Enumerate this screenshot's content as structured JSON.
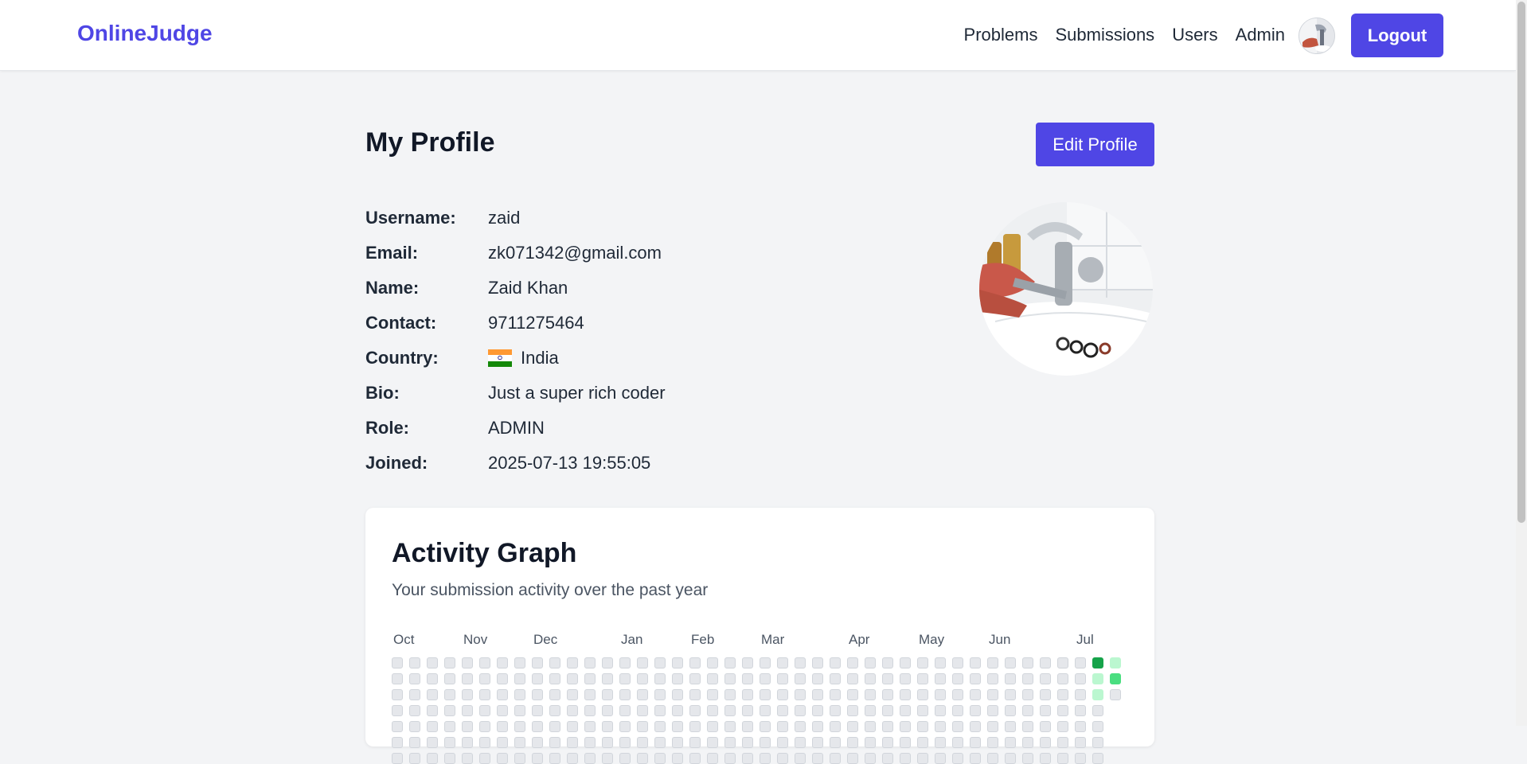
{
  "nav": {
    "brand": "OnlineJudge",
    "links": [
      "Problems",
      "Submissions",
      "Users",
      "Admin"
    ],
    "logout_label": "Logout"
  },
  "profile": {
    "title": "My Profile",
    "edit_label": "Edit Profile",
    "fields": [
      {
        "label": "Username:",
        "value": "zaid"
      },
      {
        "label": "Email:",
        "value": "zk071342@gmail.com"
      },
      {
        "label": "Name:",
        "value": "Zaid Khan"
      },
      {
        "label": "Contact:",
        "value": "9711275464"
      },
      {
        "label": "Country:",
        "value": "India",
        "flag": true
      },
      {
        "label": "Bio:",
        "value": "Just a super rich coder"
      },
      {
        "label": "Role:",
        "value": "ADMIN"
      },
      {
        "label": "Joined:",
        "value": "2025-07-13 19:55:05"
      }
    ]
  },
  "activity": {
    "title": "Activity Graph",
    "subtitle": "Your submission activity over the past year",
    "months": [
      {
        "label": "Oct",
        "week": 0
      },
      {
        "label": "Nov",
        "week": 4
      },
      {
        "label": "Dec",
        "week": 8
      },
      {
        "label": "Jan",
        "week": 13
      },
      {
        "label": "Feb",
        "week": 17
      },
      {
        "label": "Mar",
        "week": 21
      },
      {
        "label": "Apr",
        "week": 26
      },
      {
        "label": "May",
        "week": 30
      },
      {
        "label": "Jun",
        "week": 34
      },
      {
        "label": "Jul",
        "week": 39
      }
    ],
    "weeks": 42,
    "colors": {
      "empty": "#e5e7eb",
      "light": "#bbf7d0",
      "mid": "#4ade80",
      "dark": "#16a34a"
    },
    "active_cells": [
      {
        "week": 40,
        "day": 0,
        "level": "dark"
      },
      {
        "week": 40,
        "day": 1,
        "level": "light"
      },
      {
        "week": 40,
        "day": 2,
        "level": "light"
      },
      {
        "week": 41,
        "day": 0,
        "level": "light"
      },
      {
        "week": 41,
        "day": 1,
        "level": "mid"
      }
    ],
    "last_week_days": 3
  },
  "colors": {
    "accent": "#4f46e5",
    "india_saffron": "#ff9933",
    "india_white": "#ffffff",
    "india_green": "#138808"
  }
}
